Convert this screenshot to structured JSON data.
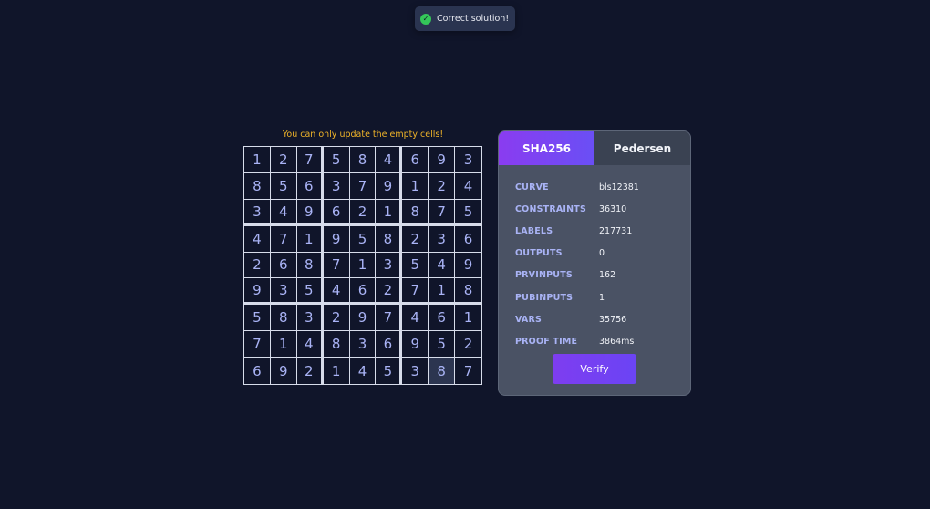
{
  "toast": {
    "message": "Correct solution!",
    "status": "success",
    "icon": "check-circle-icon"
  },
  "warning": "You can only update the empty cells!",
  "board": [
    [
      "1",
      "2",
      "7",
      "5",
      "8",
      "4",
      "6",
      "9",
      "3"
    ],
    [
      "8",
      "5",
      "6",
      "3",
      "7",
      "9",
      "1",
      "2",
      "4"
    ],
    [
      "3",
      "4",
      "9",
      "6",
      "2",
      "1",
      "8",
      "7",
      "5"
    ],
    [
      "4",
      "7",
      "1",
      "9",
      "5",
      "8",
      "2",
      "3",
      "6"
    ],
    [
      "2",
      "6",
      "8",
      "7",
      "1",
      "3",
      "5",
      "4",
      "9"
    ],
    [
      "9",
      "3",
      "5",
      "4",
      "6",
      "2",
      "7",
      "1",
      "8"
    ],
    [
      "5",
      "8",
      "3",
      "2",
      "9",
      "7",
      "4",
      "6",
      "1"
    ],
    [
      "7",
      "1",
      "4",
      "8",
      "3",
      "6",
      "9",
      "5",
      "2"
    ],
    [
      "6",
      "9",
      "2",
      "1",
      "4",
      "5",
      "3",
      "8",
      "7"
    ]
  ],
  "selected_cell": {
    "row": 8,
    "col": 7
  },
  "panel": {
    "tabs": [
      {
        "label": "SHA256",
        "active": true
      },
      {
        "label": "Pedersen",
        "active": false
      }
    ],
    "stats": [
      {
        "key": "CURVE",
        "value": "bls12381"
      },
      {
        "key": "CONSTRAINTS",
        "value": "36310"
      },
      {
        "key": "LABELS",
        "value": "217731"
      },
      {
        "key": "OUTPUTS",
        "value": "0"
      },
      {
        "key": "PRVINPUTS",
        "value": "162"
      },
      {
        "key": "PUBINPUTS",
        "value": "1"
      },
      {
        "key": "VARS",
        "value": "35756"
      },
      {
        "key": "PROOF TIME",
        "value": "3864ms"
      }
    ],
    "verify_label": "Verify"
  },
  "colors": {
    "background": "#10152a",
    "accent": "#7e3df0",
    "digit": "#a9b3f5",
    "warning": "#f0b429",
    "success": "#34c759"
  }
}
